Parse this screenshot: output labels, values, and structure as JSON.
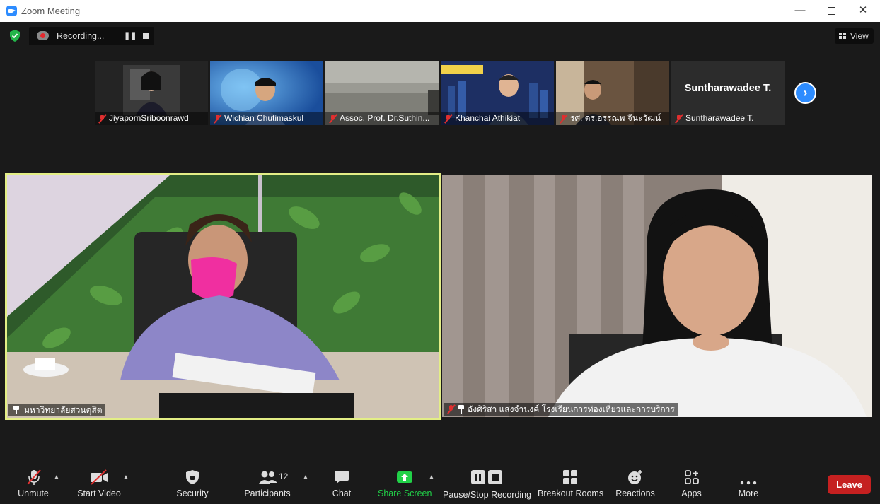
{
  "window": {
    "title": "Zoom Meeting",
    "controls": [
      "minimize-icon",
      "maximize-icon",
      "close-icon"
    ]
  },
  "recording": {
    "label": "Recording...",
    "icon": "cloud-record-icon"
  },
  "view": {
    "label": "View"
  },
  "participants_strip": [
    {
      "name": "JiyapornSriboonrawd",
      "muted": true
    },
    {
      "name": "Wichian Chutimaskul",
      "muted": true
    },
    {
      "name": "Assoc. Prof. Dr.Suthin...",
      "muted": true
    },
    {
      "name": "Khanchai Athikiat",
      "muted": true
    },
    {
      "name": "รศ. ดร.อรรณพ จีนะวัฒน์",
      "muted": true
    },
    {
      "name": "Suntharawadee T.",
      "muted": true,
      "display_text": "Suntharawadee T."
    }
  ],
  "main_tiles": [
    {
      "name": "มหาวิทยาลัยสวนดุสิต",
      "pinned": true,
      "muted": false,
      "active_speaker": true
    },
    {
      "name": "อังศิริสา แสงจำนงค์ โรงเรียนการท่องเที่ยวและการบริการ",
      "pinned": true,
      "muted": true
    }
  ],
  "toolbar": {
    "unmute": "Unmute",
    "start_video": "Start Video",
    "security": "Security",
    "participants": "Participants",
    "participants_count": "12",
    "chat": "Chat",
    "share_screen": "Share Screen",
    "pause_stop_recording": "Pause/Stop Recording",
    "breakout_rooms": "Breakout Rooms",
    "reactions": "Reactions",
    "apps": "Apps",
    "more": "More",
    "leave": "Leave"
  },
  "colors": {
    "accent_blue": "#2d8cff",
    "share_green": "#21d148",
    "leave_red": "#c52020",
    "active_speaker_border": "#e3ee86",
    "muted_red": "#e02f2f"
  }
}
